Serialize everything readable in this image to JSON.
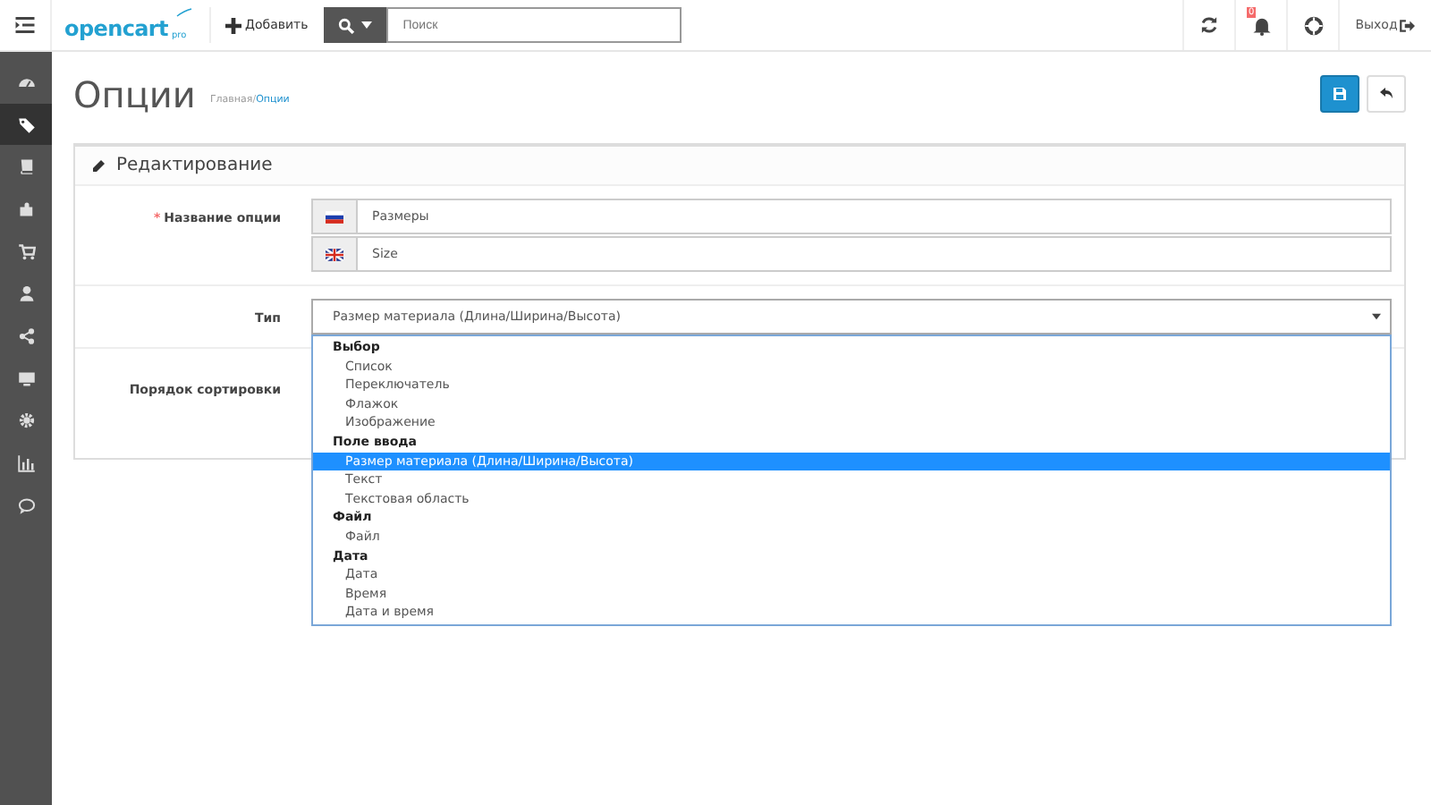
{
  "header": {
    "logo": "opencart",
    "logo_suffix": "pro",
    "add_button": "Добавить",
    "search": {
      "placeholder": "Поиск"
    },
    "notifications": "0",
    "logout": "Выход"
  },
  "sidebar": {
    "items": [
      {
        "selected": false
      },
      {
        "selected": true
      },
      {
        "selected": false
      },
      {
        "selected": false
      },
      {
        "selected": false
      },
      {
        "selected": false
      },
      {
        "selected": false
      },
      {
        "selected": false
      },
      {
        "selected": false
      },
      {
        "selected": false
      },
      {
        "selected": false
      }
    ]
  },
  "page": {
    "title": "Опции",
    "breadcrumb_separator": "/",
    "breadcrumbs": [
      {
        "label": "Главная",
        "current": false
      },
      {
        "label": "Опции",
        "current": true
      }
    ]
  },
  "panel": {
    "title": "Редактирование",
    "option_name": {
      "label": "Название опции",
      "required_mark": "*",
      "values": [
        {
          "value": "Размеры"
        },
        {
          "value": "Size"
        }
      ]
    },
    "type": {
      "label": "Тип",
      "value": "Размер материала (Длина/Ширина/Высота)",
      "open": true,
      "groups": [
        {
          "label": "Выбор",
          "options": [
            {
              "label": "Список",
              "selected": false
            },
            {
              "label": "Переключатель",
              "selected": false
            },
            {
              "label": "Флажок",
              "selected": false
            },
            {
              "label": "Изображение",
              "selected": false
            }
          ]
        },
        {
          "label": "Поле ввода",
          "options": [
            {
              "label": "Размер материала (Длина/Ширина/Высота)",
              "selected": true
            },
            {
              "label": "Текст",
              "selected": false
            },
            {
              "label": "Текстовая область",
              "selected": false
            }
          ]
        },
        {
          "label": "Файл",
          "options": [
            {
              "label": "Файл",
              "selected": false
            }
          ]
        },
        {
          "label": "Дата",
          "options": [
            {
              "label": "Дата",
              "selected": false
            },
            {
              "label": "Время",
              "selected": false
            },
            {
              "label": "Дата и время",
              "selected": false
            }
          ]
        }
      ]
    },
    "sort_order": {
      "label": "Порядок сортировки"
    }
  }
}
